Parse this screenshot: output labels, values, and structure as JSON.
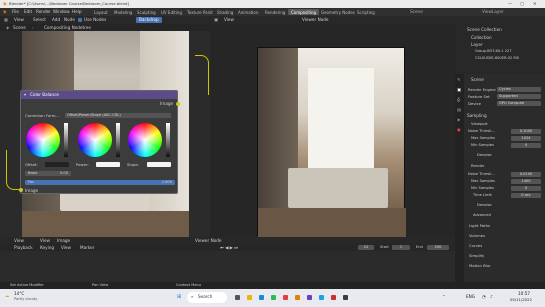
{
  "window": {
    "title": "Blender* [C:\\Users\\...\\Bedroom Course\\Bedroom_Course.blend]"
  },
  "menu": {
    "items": [
      "File",
      "Edit",
      "Render",
      "Window",
      "Help"
    ],
    "tabs": [
      "Layout",
      "Modeling",
      "Sculpting",
      "UV Editing",
      "Texture Paint",
      "Shading",
      "Animation",
      "Rendering",
      "Compositing",
      "Geometry Nodes",
      "Scripting"
    ],
    "active_tab": "Compositing",
    "scene_label": "Scene",
    "viewlayer_label": "ViewLayer"
  },
  "node_editor": {
    "header": {
      "view": "View",
      "select": "Select",
      "add": "Add",
      "node": "Node",
      "use_nodes": "Use Nodes",
      "backdrop": "Backdrop"
    },
    "breadcrumb": {
      "scene": "Scene",
      "tree": "Compositing Nodetree"
    },
    "node": {
      "title": "Color Balance",
      "output_socket": "Image",
      "method": "Offset/Power/Slope (ASC-CDL)",
      "method_short": "Correction Form...",
      "wheel_labels": [
        "Offset:",
        "Power:",
        "Slope:"
      ],
      "basis_label": "Basis",
      "basis_value": "0.00",
      "fac_label": "Fac",
      "fac_value": "1.000",
      "input_socket": "Image"
    }
  },
  "image_editor": {
    "header": {
      "view": "View",
      "view_mode": "Viewer Node"
    },
    "bottom": {
      "view": "View",
      "view2": "View",
      "image": "Image",
      "viewer": "Viewer Node"
    }
  },
  "outliner": {
    "title": "Scene Collection",
    "items": [
      "Collection",
      "Layer",
      "Group.BOT-60-1 227",
      "CSLSUSSE-600ER-02 RSI"
    ]
  },
  "properties": {
    "scene_label": "Scene",
    "render_engine_label": "Render Engine",
    "render_engine": "Cycles",
    "feature_set_label": "Feature Set",
    "feature_set": "Supported",
    "device_label": "Device",
    "device": "GPU Compute",
    "sampling_label": "Sampling",
    "viewport_label": "Viewport",
    "noise_threshold_label": "Noise Thresh...",
    "vp_noise": "0.1000",
    "max_samples_label": "Max Samples",
    "vp_max": "1024",
    "min_samples_label": "Min Samples",
    "vp_min": "0",
    "denoise_label": "Denoise",
    "render_label": "Render",
    "r_noise": "0.0100",
    "r_max": "1400",
    "r_min": "0",
    "time_limit_label": "Time Limit",
    "r_time": "0 sec",
    "advanced_label": "Advanced",
    "light_paths_label": "Light Paths",
    "volumes_label": "Volumes",
    "curves_label": "Curves",
    "simplify_label": "Simplify",
    "motion_blur_label": "Motion Blur"
  },
  "timeline": {
    "playback": "Playback",
    "keying": "Keying",
    "view": "View",
    "marker": "Marker",
    "frame": "12",
    "start_label": "Start",
    "start": "1",
    "end_label": "End",
    "end": "250"
  },
  "statusbar": {
    "left": "Set Active Modifier",
    "mid": "Pan View",
    "right": "Context Menu"
  },
  "taskbar": {
    "weather_temp": "14°C",
    "weather_desc": "Partly cloudy",
    "search": "Search",
    "lang": "ENG",
    "time": "10:57",
    "date": "05/11/2022"
  },
  "colors": {
    "accent": "#4772b3",
    "node_header": "#5b4b8a",
    "compositing_tab": "#595959"
  }
}
